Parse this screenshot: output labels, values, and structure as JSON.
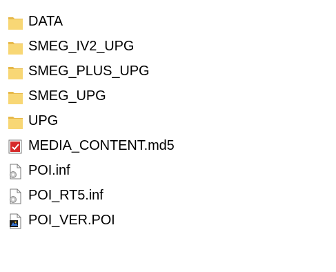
{
  "items": [
    {
      "label": "DATA",
      "icon": "folder-icon",
      "type": "folder"
    },
    {
      "label": "SMEG_IV2_UPG",
      "icon": "folder-icon",
      "type": "folder"
    },
    {
      "label": "SMEG_PLUS_UPG",
      "icon": "folder-icon",
      "type": "folder"
    },
    {
      "label": "SMEG_UPG",
      "icon": "folder-icon",
      "type": "folder"
    },
    {
      "label": "UPG",
      "icon": "folder-icon",
      "type": "folder"
    },
    {
      "label": "MEDIA_CONTENT.md5",
      "icon": "checksum-file-icon",
      "type": "file"
    },
    {
      "label": "POI.inf",
      "icon": "settings-file-icon",
      "type": "file"
    },
    {
      "label": "POI_RT5.inf",
      "icon": "settings-file-icon",
      "type": "file"
    },
    {
      "label": "POI_VER.POI",
      "icon": "media-file-icon",
      "type": "file"
    }
  ],
  "colors": {
    "folder_main": "#F8D775",
    "folder_tab": "#E7B94A",
    "checksum_red": "#D62A2A",
    "page_border": "#7A7A7A"
  }
}
